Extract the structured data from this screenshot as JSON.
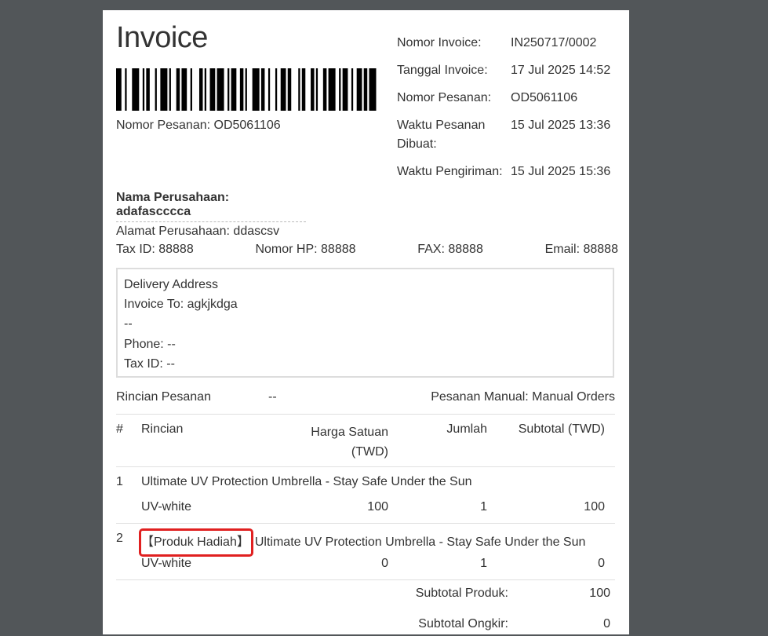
{
  "invoice": {
    "title": "Invoice",
    "barcode_caption": "Nomor Pesanan: OD5061106",
    "meta": [
      {
        "label": "Nomor Invoice:",
        "value": "IN250717/0002"
      },
      {
        "label": "Tanggal Invoice:",
        "value": "17 Jul 2025 14:52"
      },
      {
        "label": "Nomor Pesanan:",
        "value": "OD5061106"
      },
      {
        "label": "Waktu Pesanan Dibuat:",
        "value": "15 Jul 2025 13:36"
      },
      {
        "label": "Waktu Pengiriman:",
        "value": "15 Jul 2025 15:36"
      }
    ]
  },
  "company": {
    "name": "Nama Perusahaan: adafascccca",
    "address": "Alamat Perusahaan: ddascsv",
    "tax_id": "Tax ID: 88888",
    "phone": "Nomor HP: 88888",
    "fax": "FAX: 88888",
    "email": "Email: 88888"
  },
  "delivery": {
    "heading": "Delivery Address",
    "invoice_to": "Invoice To: agkjkdga",
    "line": "--",
    "phone": "Phone: --",
    "tax_id": "Tax ID: --"
  },
  "order": {
    "details_label": "Rincian Pesanan",
    "details_value": "--",
    "manual_order": "Pesanan Manual: Manual Orders"
  },
  "table": {
    "headers": {
      "num": "#",
      "detail": "Rincian",
      "price_line1": "Harga Satuan",
      "price_line2": "(TWD)",
      "qty": "Jumlah",
      "subtotal": "Subtotal (TWD)"
    },
    "rows": [
      {
        "num": "1",
        "badge": "",
        "name": "Ultimate UV Protection Umbrella - Stay Safe Under the Sun",
        "variant": "UV-white",
        "price": "100",
        "qty": "1",
        "subtotal": "100"
      },
      {
        "num": "2",
        "badge": "【Produk Hadiah】",
        "name": "Ultimate UV Protection Umbrella - Stay Safe Under the Sun",
        "variant": "UV-white",
        "price": "0",
        "qty": "1",
        "subtotal": "0"
      }
    ]
  },
  "totals": [
    {
      "label": "Subtotal Produk:",
      "value": "100"
    },
    {
      "label": "Subtotal Ongkir:",
      "value": "0"
    }
  ],
  "colors": {
    "background": "#525659",
    "paper": "#ffffff",
    "highlight": "#e02020"
  }
}
